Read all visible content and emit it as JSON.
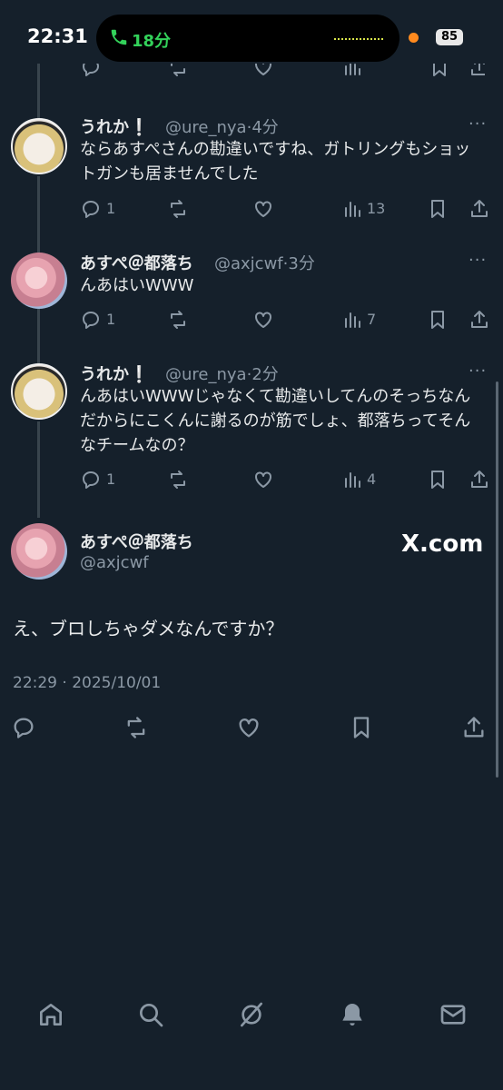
{
  "status_bar": {
    "time": "22:31",
    "call_duration": "18分",
    "battery": "85"
  },
  "thread": [
    {
      "name": "うれか❕",
      "handle": "@ure_nya",
      "time": "4分",
      "text": "ならあすぺさんの勘違いですね、ガトリングもショットガンも居ませんでした",
      "replies": "1",
      "views": "13"
    },
    {
      "name": "あすぺ＠都落ち",
      "handle": "@axjcwf",
      "time": "3分",
      "text": "んあはいWWW",
      "replies": "1",
      "views": "7"
    },
    {
      "name": "うれか❕",
      "handle": "@ure_nya",
      "time": "2分",
      "text": "んあはいWWWじゃなくて勘違いしてんのそっちなんだからにこくんに謝るのが筋でしょ、都落ちってそんなチームなの？",
      "replies": "1",
      "views": "4"
    }
  ],
  "main_post": {
    "name": "あすぺ＠都落ち",
    "handle": "@axjcwf",
    "watermark": "X.com",
    "text": "え、ブロしちゃダメなんですか？",
    "timestamp": "22:29 · 2025/10/01"
  },
  "separator": "·",
  "more": "···",
  "icons": {
    "reply": "reply-icon",
    "retweet": "retweet-icon",
    "like": "like-icon",
    "views": "views-icon",
    "bookmark": "bookmark-icon",
    "share": "share-icon",
    "home": "home-icon",
    "search": "search-icon",
    "grok": "grok-icon",
    "notifications": "bell-icon",
    "messages": "mail-icon"
  },
  "colors": {
    "background": "#15202b",
    "text": "#e7e9ea",
    "muted": "#8b98a5",
    "call_green": "#33d15a"
  }
}
